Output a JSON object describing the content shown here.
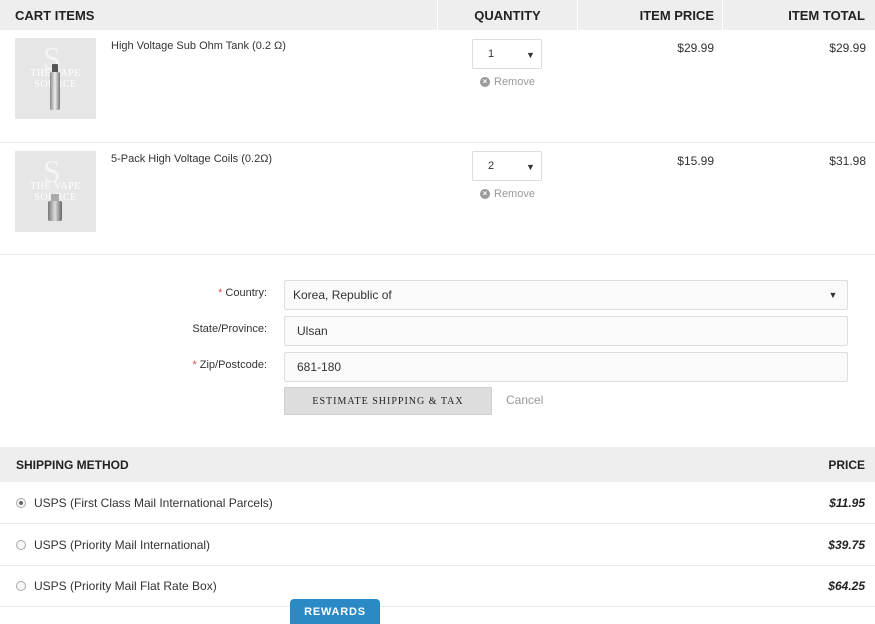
{
  "cart_header": {
    "items": "CART ITEMS",
    "quantity": "QUANTITY",
    "item_price": "ITEM PRICE",
    "item_total": "ITEM TOTAL"
  },
  "cart_items": [
    {
      "name": "High Voltage Sub Ohm Tank (0.2 Ω)",
      "quantity": "1",
      "remove_label": "Remove",
      "price": "$29.99",
      "total": "$29.99",
      "thumb_watermark": "THE VAPE SOURCE",
      "thumb_icon": "tank-image"
    },
    {
      "name": "5-Pack High Voltage Coils (0.2Ω)",
      "quantity": "2",
      "remove_label": "Remove",
      "price": "$15.99",
      "total": "$31.98",
      "thumb_watermark": "THE VAPE SOURCE",
      "thumb_icon": "coil-image"
    }
  ],
  "estimate_form": {
    "country_label": "Country:",
    "country_value": "Korea, Republic of",
    "state_label": "State/Province:",
    "state_value": "Ulsan",
    "zip_label": "Zip/Postcode:",
    "zip_value": "681-180",
    "required_marker": "*",
    "estimate_button": "ESTIMATE SHIPPING & TAX",
    "cancel_link": "Cancel"
  },
  "shipping": {
    "header_method": "SHIPPING METHOD",
    "header_price": "PRICE",
    "options": [
      {
        "name": "USPS (First Class Mail International Parcels)",
        "price": "$11.95",
        "selected": true
      },
      {
        "name": "USPS (Priority Mail International)",
        "price": "$39.75",
        "selected": false
      },
      {
        "name": "USPS (Priority Mail Flat Rate Box)",
        "price": "$64.25",
        "selected": false
      }
    ]
  },
  "rewards_tab": "REWARDS",
  "colors": {
    "header_bg": "#eeeeee",
    "rewards_blue": "#2b8ac6",
    "required_red": "#d9534f",
    "muted_text": "#999999"
  }
}
